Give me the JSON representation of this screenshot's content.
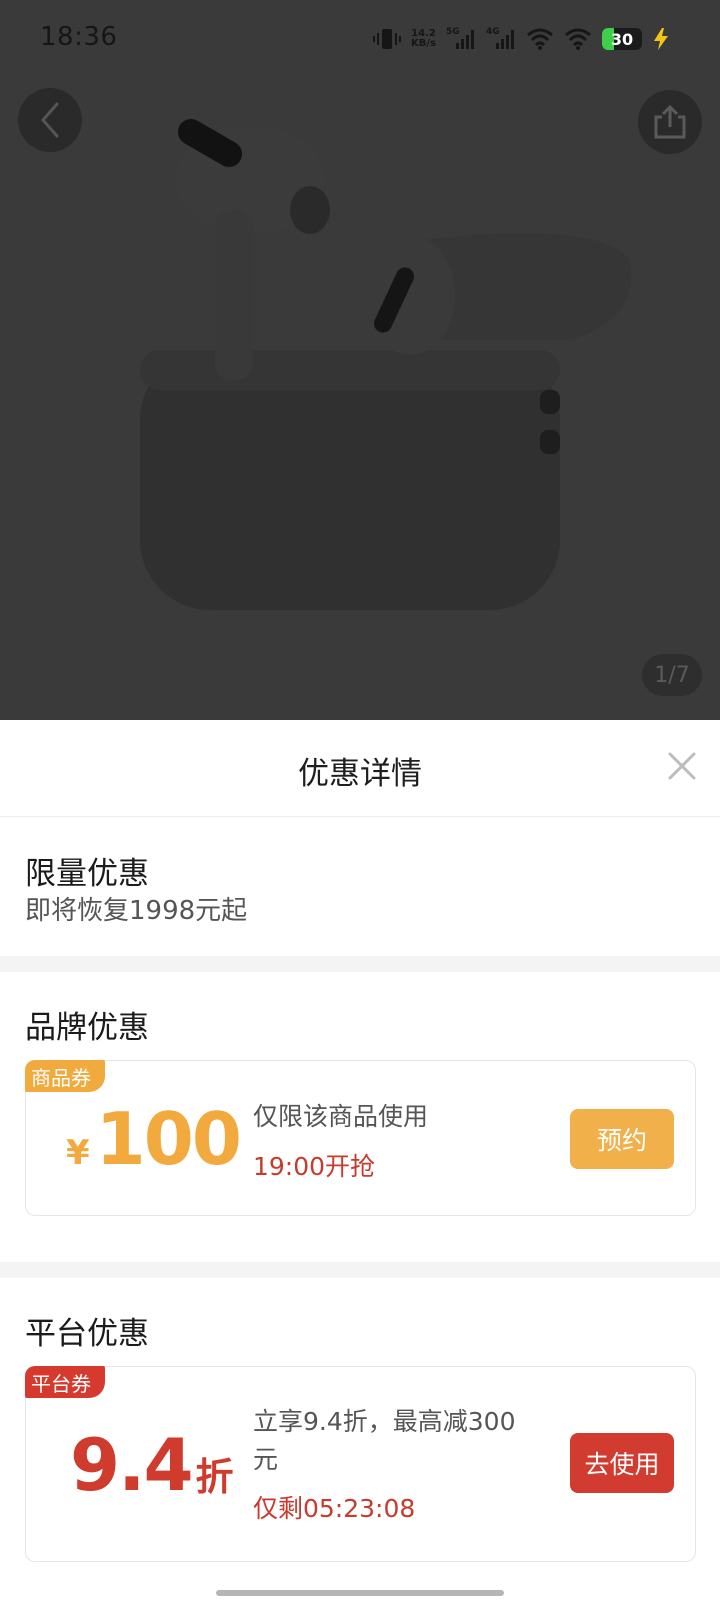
{
  "status_bar": {
    "time": "18:36",
    "speed_value": "14.2",
    "speed_unit": "KB/s",
    "net1": "5G",
    "net2": "4G",
    "battery": "30",
    "icons": [
      "vibrate-icon",
      "signal-5g-icon",
      "signal-4g-icon",
      "wifi-icon",
      "wifi-icon",
      "battery-icon",
      "charging-bolt-icon"
    ]
  },
  "gallery": {
    "page_indicator": "1/7",
    "back_icon": "chevron-left-icon",
    "share_icon": "share-icon"
  },
  "sheet": {
    "title": "优惠详情",
    "close_icon": "close-icon",
    "limited": {
      "title": "限量优惠",
      "subtitle": "即将恢复1998元起"
    },
    "brand": {
      "title": "品牌优惠",
      "coupon": {
        "tag": "商品券",
        "currency": "¥",
        "amount": "100",
        "description": "仅限该商品使用",
        "time_note": "19:00开抢",
        "button": "预约"
      }
    },
    "platform": {
      "title": "平台优惠",
      "coupon": {
        "tag": "平台券",
        "amount": "9.4",
        "unit": "折",
        "description_line1": "立享9.4折，最高减300",
        "description_line2": "元",
        "countdown": "仅剩05:23:08",
        "button": "去使用"
      }
    }
  },
  "colors": {
    "accent_orange": "#f2aa3f",
    "accent_red": "#cf3b2d",
    "overlay": "#3a3a3a"
  }
}
